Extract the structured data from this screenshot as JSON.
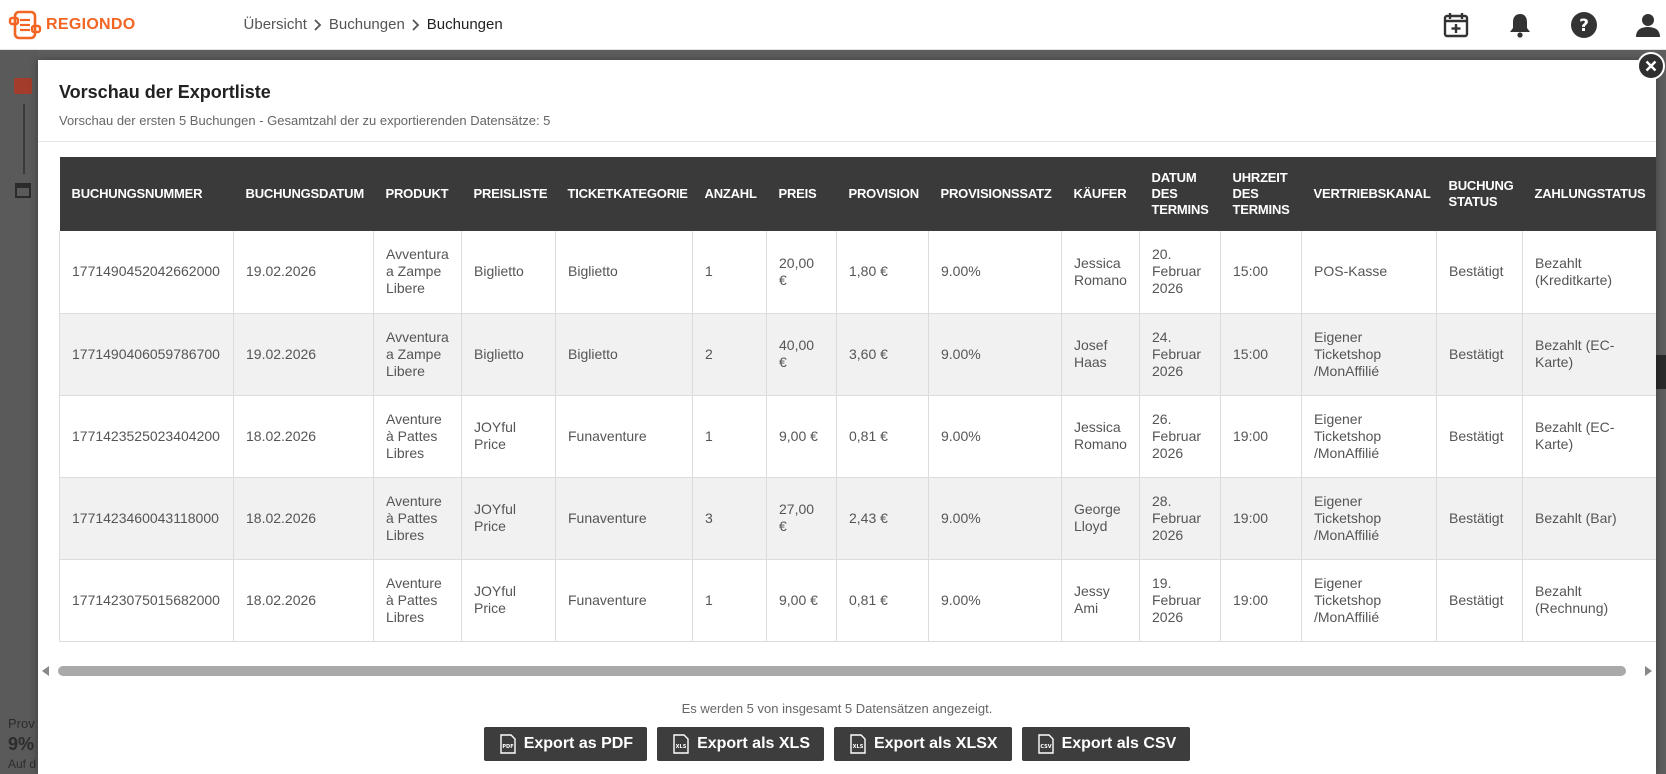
{
  "app": {
    "brand": "REGIONDO",
    "brand_color": "#f26522"
  },
  "breadcrumb": [
    {
      "label": "Übersicht"
    },
    {
      "label": "Buchungen"
    },
    {
      "label": "Buchungen"
    }
  ],
  "top_icons": [
    "calendar-add-icon",
    "bell-icon",
    "help-icon",
    "user-icon"
  ],
  "background": {
    "prov_label": "Prov",
    "prov_value": "9%",
    "auf_label": "Auf d"
  },
  "modal": {
    "title": "Vorschau der Exportliste",
    "subtitle": "Vorschau der ersten 5 Buchungen - Gesamtzahl der zu exportierenden Datensätze: 5",
    "record_info": "Es werden 5 von insgesamt 5 Datensätzen angezeigt."
  },
  "table": {
    "columns": [
      "BUCHUNGSNUMMER",
      "BUCHUNGSDATUM",
      "PRODUKT",
      "PREISLISTE",
      "TICKETKATEGORIE",
      "ANZAHL",
      "PREIS",
      "PROVISION",
      "PROVISIONSSATZ",
      "KÄUFER",
      "DATUM DES TERMINS",
      "UHRZEIT DES TERMINS",
      "VERTRIEBSKANAL",
      "BUCHUNG STATUS",
      "ZAHLUNGSTATUS"
    ],
    "rows": [
      [
        "1771490452042662000",
        "19.02.2026",
        "Avventura a Zampe Libere",
        "Biglietto",
        "Biglietto",
        "1",
        "20,00 €",
        "1,80 €",
        "9.00%",
        "Jessica Romano",
        "20. Februar 2026",
        "15:00",
        "POS-Kasse",
        "Bestätigt",
        "Bezahlt (Kreditkarte)"
      ],
      [
        "1771490406059786700",
        "19.02.2026",
        "Avventura a Zampe Libere",
        "Biglietto",
        "Biglietto",
        "2",
        "40,00 €",
        "3,60 €",
        "9.00%",
        "Josef Haas",
        "24. Februar 2026",
        "15:00",
        "Eigener Ticketshop /MonAffilié",
        "Bestätigt",
        "Bezahlt (EC-Karte)"
      ],
      [
        "1771423525023404200",
        "18.02.2026",
        "Aventure à Pattes Libres",
        "JOYful Price",
        "Funaventure",
        "1",
        "9,00 €",
        "0,81 €",
        "9.00%",
        "Jessica Romano",
        "26. Februar 2026",
        "19:00",
        "Eigener Ticketshop /MonAffilié",
        "Bestätigt",
        "Bezahlt (EC-Karte)"
      ],
      [
        "1771423460043118000",
        "18.02.2026",
        "Aventure à Pattes Libres",
        "JOYful Price",
        "Funaventure",
        "3",
        "27,00 €",
        "2,43 €",
        "9.00%",
        "George Lloyd",
        "28. Februar 2026",
        "19:00",
        "Eigener Ticketshop /MonAffilié",
        "Bestätigt",
        "Bezahlt (Bar)"
      ],
      [
        "1771423075015682000",
        "18.02.2026",
        "Aventure à Pattes Libres",
        "JOYful Price",
        "Funaventure",
        "1",
        "9,00 €",
        "0,81 €",
        "9.00%",
        "Jessy Ami",
        "19. Februar 2026",
        "19:00",
        "Eigener Ticketshop /MonAffilié",
        "Bestätigt",
        "Bezahlt (Rechnung)"
      ]
    ]
  },
  "export_buttons": [
    {
      "label": "Export as PDF",
      "icon": "pdf-file-icon",
      "icon_text": "PDF"
    },
    {
      "label": "Export als XLS",
      "icon": "xls-file-icon",
      "icon_text": "XLS"
    },
    {
      "label": "Export als XLSX",
      "icon": "xlsx-file-icon",
      "icon_text": "XLS"
    },
    {
      "label": "Export als CSV",
      "icon": "csv-file-icon",
      "icon_text": "CSV"
    }
  ]
}
